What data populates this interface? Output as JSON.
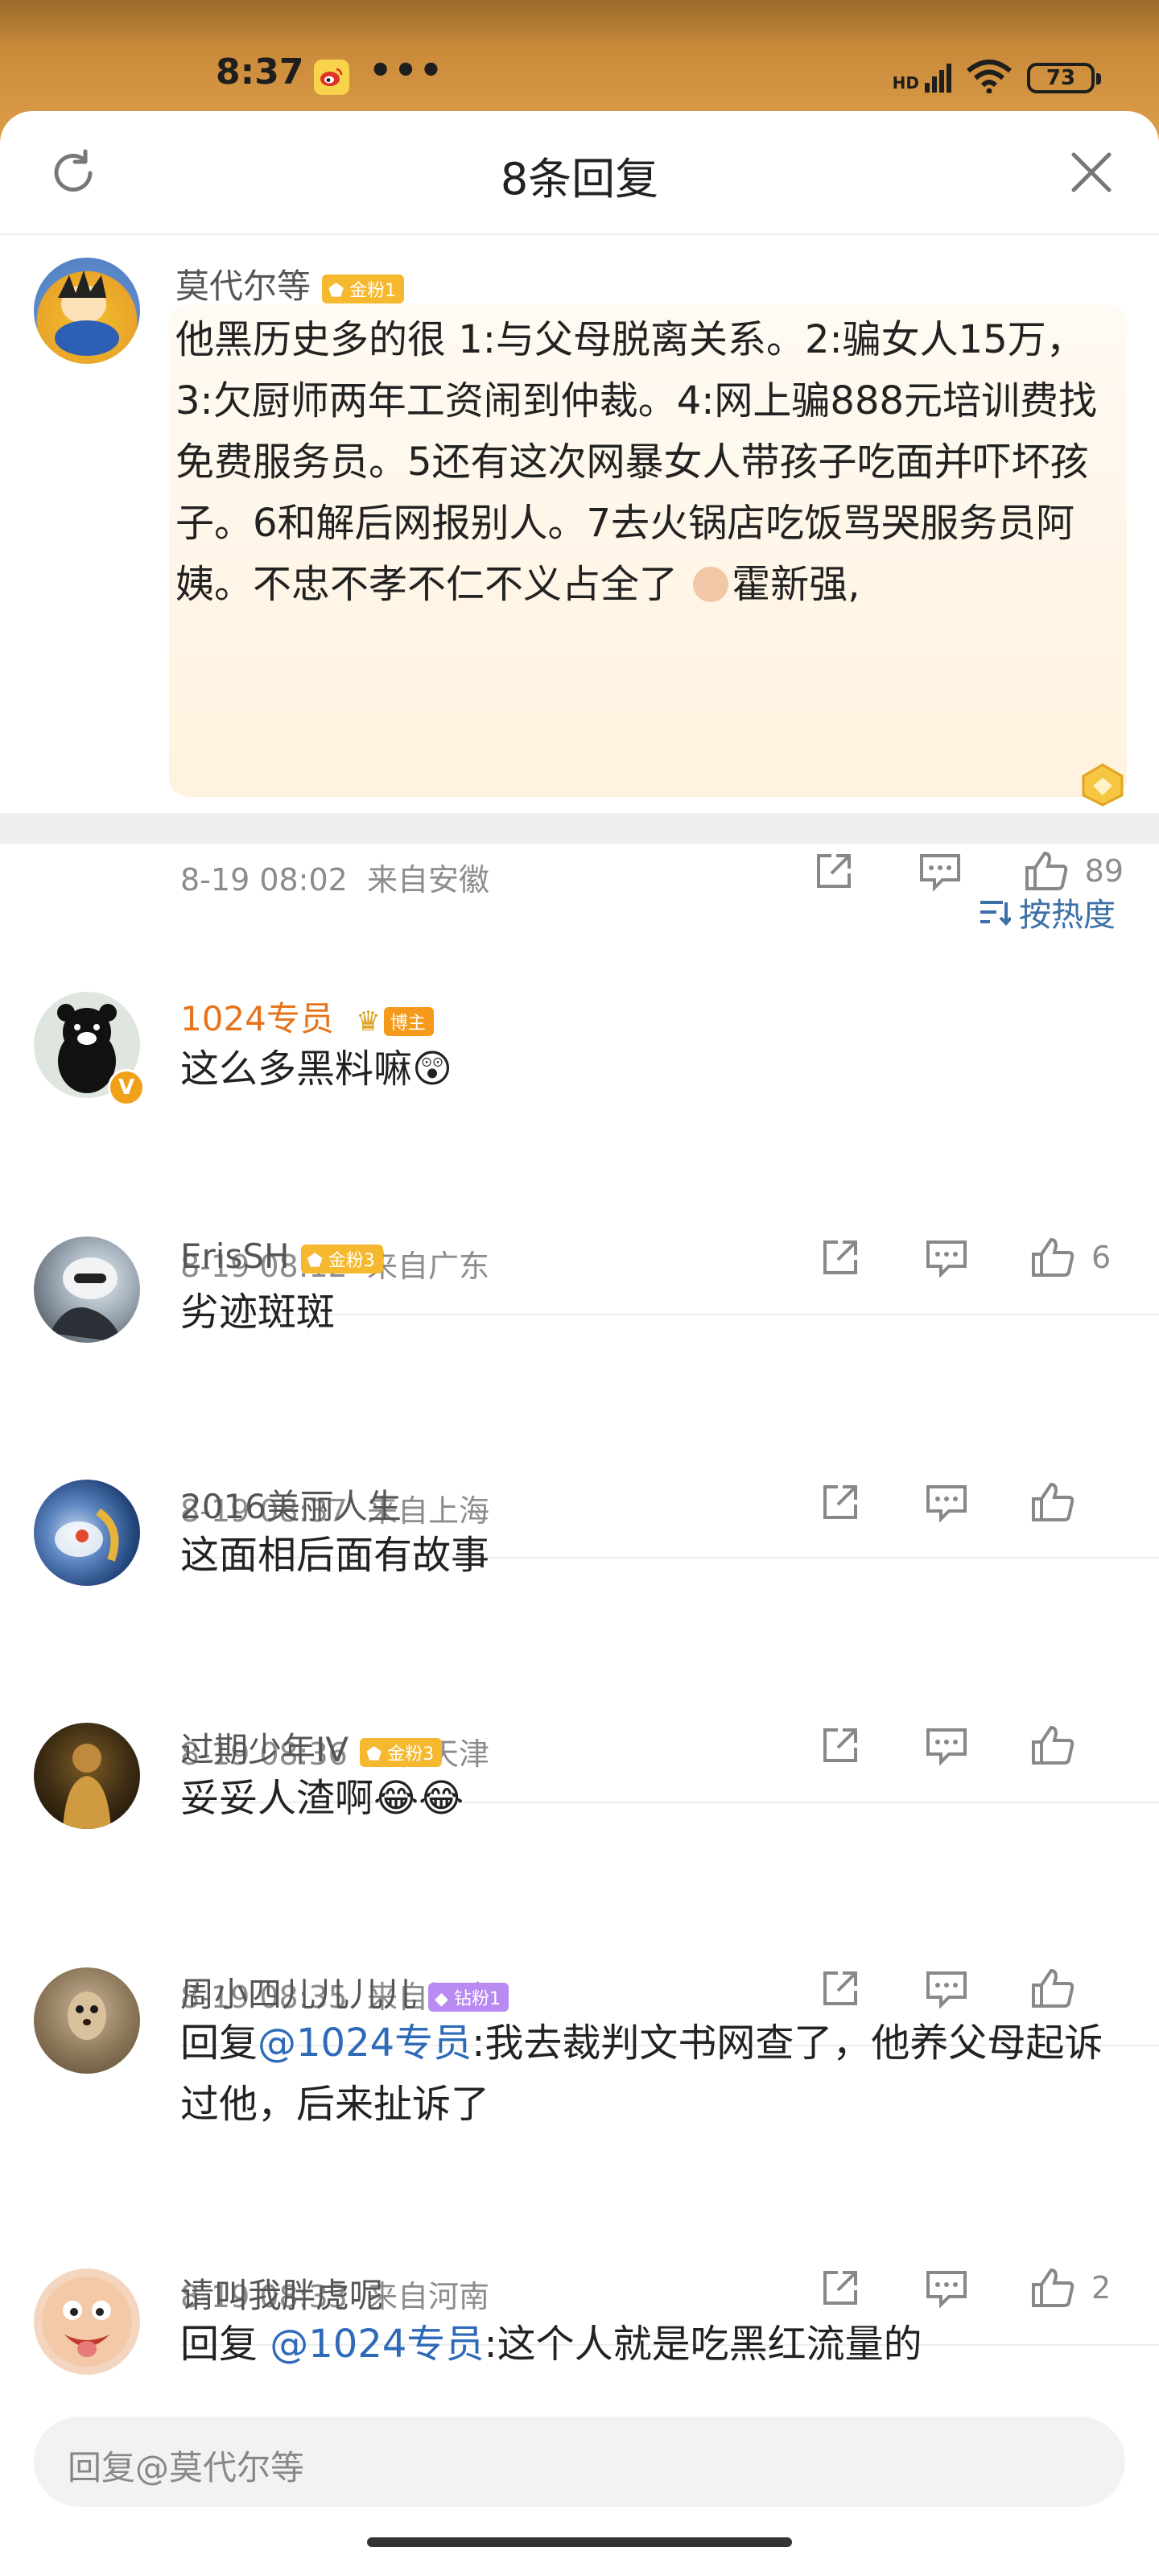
{
  "status_bar": {
    "time": "8:37",
    "dots": "•••",
    "battery": "73",
    "network": "HD"
  },
  "header": {
    "title": "8条回复"
  },
  "main_comment": {
    "username": "莫代尔等",
    "badge": "金粉1",
    "text": "他黑历史多的很  1:与父母脱离关系。2:骗女人15万，3:欠厨师两年工资闹到仲裁。4:网上骗888元培训费找免费服务员。5还有这次网暴女人带孩子吃面并吓坏孩子。6和解后网报别人。7去火锅店吃饭骂哭服务员阿姨。不忠不孝不仁不义占全了",
    "text_tail": "霍新强,",
    "time": "8-19 08:02",
    "location": "来自安徽",
    "likes": "89"
  },
  "sort": {
    "label": "按热度"
  },
  "replies": [
    {
      "username": "1024专员",
      "badge": "博主",
      "badge_type": "host",
      "text": "这么多黑料嘛",
      "emoji": "😲",
      "time": "8-19 08:12",
      "location": "来自广东",
      "likes": "6"
    },
    {
      "username": "ErisSH",
      "badge": "金粉3",
      "badge_type": "gold",
      "text": "劣迹斑斑",
      "emoji": "",
      "time": "8-19 08:37",
      "location": "来自上海",
      "likes": ""
    },
    {
      "username": "2016美丽人生",
      "badge": "",
      "badge_type": "",
      "text": "这面相后面有故事",
      "emoji": "",
      "time": "8-19 08:36",
      "location": "来自天津",
      "likes": ""
    },
    {
      "username": "过期少年IV",
      "badge": "金粉3",
      "badge_type": "gold",
      "text": "妥妥人渣啊",
      "emoji": "😂😂",
      "time": "8-19 08:35",
      "location": "来自福建",
      "likes": ""
    },
    {
      "username": "周小四儿儿儿儿",
      "badge": "钻粉1",
      "badge_type": "purple",
      "prefix": "回复",
      "mention": "@1024专员",
      "text": ":我去裁判文书网查了，他养父母起诉过他，后来扯诉了",
      "time": "8-19 08:33",
      "location": "来自河南",
      "likes": "2"
    },
    {
      "username": "请叫我胖虎呢",
      "badge": "",
      "badge_type": "",
      "prefix": "回复 ",
      "mention": "@1024专员",
      "text": ":这个人就是吃黑红流量的",
      "time": "",
      "location": "",
      "likes": ""
    }
  ],
  "input": {
    "placeholder": "回复@莫代尔等"
  },
  "colors": {
    "accent_orange": "#e6741c",
    "link_blue": "#2e6ab8",
    "gold_badge": "#f5b82e"
  }
}
